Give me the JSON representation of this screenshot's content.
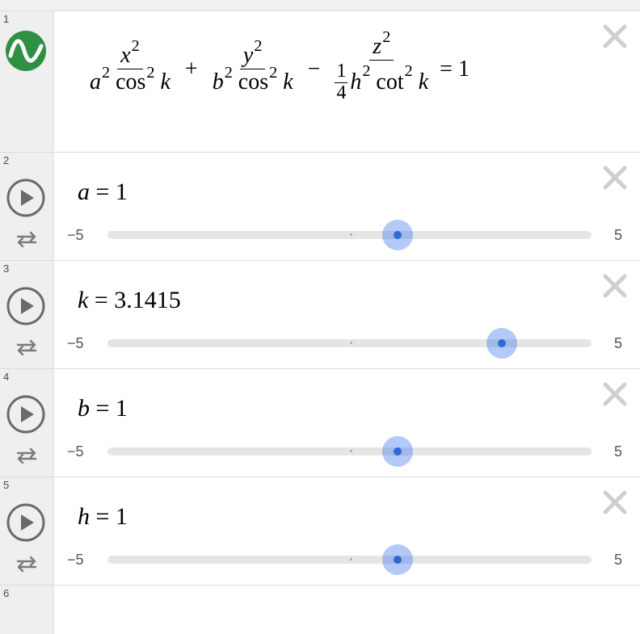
{
  "expressions": [
    {
      "number": "1",
      "icon": "graph-wave-icon",
      "color": "#2f8f43",
      "equation": {
        "t1_num_var": "x",
        "t1_num_exp": "2",
        "t1_den_a": "a",
        "t1_den_a_exp": "2",
        "t1_den_fn": "cos",
        "t1_den_fn_exp": "2",
        "t1_den_k": "k",
        "op1": "+",
        "t2_num_var": "y",
        "t2_num_exp": "2",
        "t2_den_b": "b",
        "t2_den_b_exp": "2",
        "t2_den_fn": "cos",
        "t2_den_fn_exp": "2",
        "t2_den_k": "k",
        "op2": "−",
        "t3_num_var": "z",
        "t3_num_exp": "2",
        "t3_coef_num": "1",
        "t3_coef_den": "4",
        "t3_den_h": "h",
        "t3_den_h_exp": "2",
        "t3_den_fn": "cot",
        "t3_den_fn_exp": "2",
        "t3_den_k": "k",
        "rhs": "= 1"
      }
    }
  ],
  "sliders": [
    {
      "number": "2",
      "var": "a",
      "eq": "= 1",
      "min": "−5",
      "max": "5",
      "value": 1
    },
    {
      "number": "3",
      "var": "k",
      "eq": "= 3.1415",
      "min": "−5",
      "max": "5",
      "value": 3.1415
    },
    {
      "number": "4",
      "var": "b",
      "eq": "= 1",
      "min": "−5",
      "max": "5",
      "value": 1
    },
    {
      "number": "5",
      "var": "h",
      "eq": "= 1",
      "min": "−5",
      "max": "5",
      "value": 1
    }
  ],
  "empty_row": {
    "number": "6"
  },
  "colors": {
    "accent": "#2b6ad8",
    "thumb_halo": "#a9c1f0",
    "track": "#e5e5e5",
    "logo_green": "#2f8f43"
  }
}
